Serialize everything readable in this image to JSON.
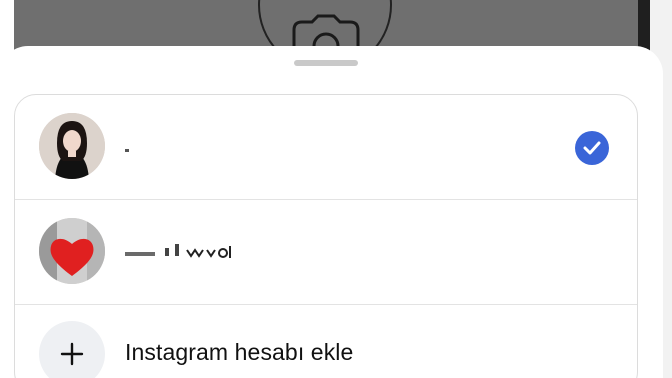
{
  "account_switcher": {
    "accounts": [
      {
        "name": "",
        "selected": true
      },
      {
        "name": "",
        "selected": false
      }
    ],
    "add_account_label": "Instagram hesabı ekle"
  },
  "colors": {
    "check_blue": "#3a65d8",
    "backdrop_gray": "#6f6f6f"
  },
  "icons": [
    "camera-icon",
    "checkmark-icon",
    "plus-icon",
    "heart-icon"
  ]
}
